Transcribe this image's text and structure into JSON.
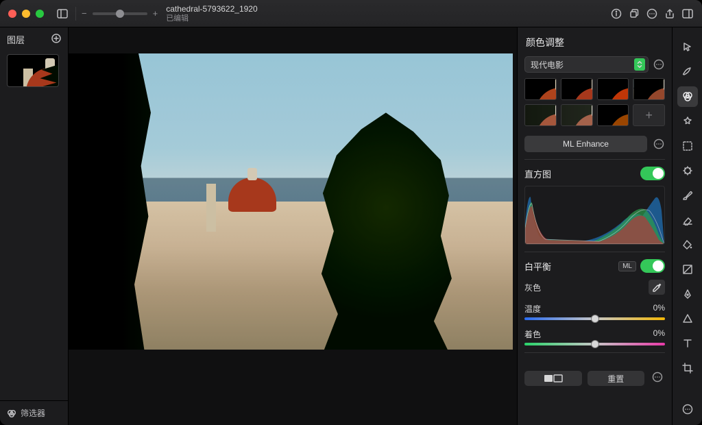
{
  "titlebar": {
    "filename": "cathedral-5793622_1920",
    "edited_label": "已编辑"
  },
  "left_panel": {
    "title": "图层",
    "footer_label": "筛选器"
  },
  "right_panel": {
    "title": "颜色调整",
    "preset_selected": "现代电影",
    "ml_enhance_label": "ML Enhance",
    "histogram_label": "直方图",
    "white_balance": {
      "label": "白平衡",
      "ml_chip": "ML"
    },
    "grey": {
      "label": "灰色"
    },
    "temperature": {
      "label": "温度",
      "value": "0%"
    },
    "tint": {
      "label": "着色",
      "value": "0%"
    },
    "reset_label": "重置"
  }
}
